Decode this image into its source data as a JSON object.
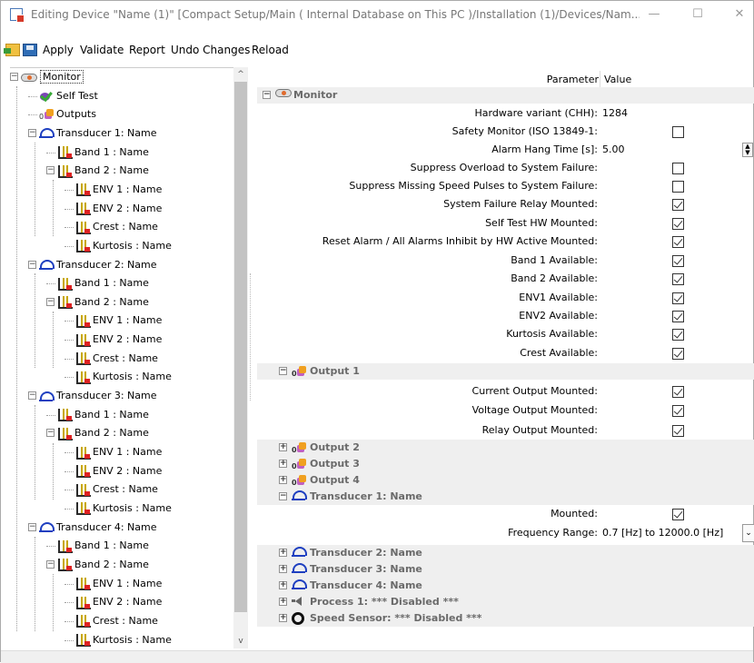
{
  "window": {
    "title": "Editing Device \"Name (1)\" [Compact Setup/Main ( Internal Database on This PC )/Installation (1)/Devices/Nam...",
    "minimize": "—",
    "maximize": "☐",
    "close": "✕"
  },
  "toolbar": {
    "apply": "Apply",
    "validate": "Validate",
    "report": "Report",
    "undo": "Undo Changes",
    "reload": "Reload"
  },
  "tree": [
    {
      "label": "Monitor",
      "icon": "monitor-icon",
      "depth": 0,
      "expander": "minus",
      "selected": true
    },
    {
      "label": "Self Test",
      "icon": "self-test-icon",
      "depth": 1
    },
    {
      "label": "Outputs",
      "icon": "outputs-icon",
      "depth": 1
    },
    {
      "label": "Transducer 1: Name",
      "icon": "transducer-icon",
      "depth": 1,
      "expander": "minus"
    },
    {
      "label": "Band 1 : Name",
      "icon": "band-icon",
      "depth": 2
    },
    {
      "label": "Band 2 : Name",
      "icon": "band-icon",
      "depth": 2,
      "expander": "minus"
    },
    {
      "label": "ENV 1 : Name",
      "icon": "band-icon",
      "depth": 3
    },
    {
      "label": "ENV 2 : Name",
      "icon": "band-icon",
      "depth": 3
    },
    {
      "label": "Crest : Name",
      "icon": "band-icon",
      "depth": 3
    },
    {
      "label": "Kurtosis : Name",
      "icon": "band-icon",
      "depth": 3
    },
    {
      "label": "Transducer 2: Name",
      "icon": "transducer-icon",
      "depth": 1,
      "expander": "minus"
    },
    {
      "label": "Band 1 : Name",
      "icon": "band-icon",
      "depth": 2
    },
    {
      "label": "Band 2 : Name",
      "icon": "band-icon",
      "depth": 2,
      "expander": "minus"
    },
    {
      "label": "ENV 1 : Name",
      "icon": "band-icon",
      "depth": 3
    },
    {
      "label": "ENV 2 : Name",
      "icon": "band-icon",
      "depth": 3
    },
    {
      "label": "Crest : Name",
      "icon": "band-icon",
      "depth": 3
    },
    {
      "label": "Kurtosis : Name",
      "icon": "band-icon",
      "depth": 3
    },
    {
      "label": "Transducer 3: Name",
      "icon": "transducer-icon",
      "depth": 1,
      "expander": "minus"
    },
    {
      "label": "Band 1 : Name",
      "icon": "band-icon",
      "depth": 2
    },
    {
      "label": "Band 2 : Name",
      "icon": "band-icon",
      "depth": 2,
      "expander": "minus"
    },
    {
      "label": "ENV 1 : Name",
      "icon": "band-icon",
      "depth": 3
    },
    {
      "label": "ENV 2 : Name",
      "icon": "band-icon",
      "depth": 3
    },
    {
      "label": "Crest : Name",
      "icon": "band-icon",
      "depth": 3
    },
    {
      "label": "Kurtosis : Name",
      "icon": "band-icon",
      "depth": 3
    },
    {
      "label": "Transducer 4: Name",
      "icon": "transducer-icon",
      "depth": 1,
      "expander": "minus"
    },
    {
      "label": "Band 1 : Name",
      "icon": "band-icon",
      "depth": 2
    },
    {
      "label": "Band 2 : Name",
      "icon": "band-icon",
      "depth": 2,
      "expander": "minus"
    },
    {
      "label": "ENV 1 : Name",
      "icon": "band-icon",
      "depth": 3
    },
    {
      "label": "ENV 2 : Name",
      "icon": "band-icon",
      "depth": 3
    },
    {
      "label": "Crest : Name",
      "icon": "band-icon",
      "depth": 3
    },
    {
      "label": "Kurtosis : Name",
      "icon": "band-icon",
      "depth": 3
    }
  ],
  "grid": {
    "header_parameter": "Parameter",
    "header_value": "Value",
    "rows": [
      {
        "kind": "group",
        "label": "Monitor",
        "icon": "monitor-icon",
        "indent": 0,
        "expander": "minus"
      },
      {
        "kind": "value",
        "label": "Hardware variant (CHH):",
        "value": "1284"
      },
      {
        "kind": "check",
        "label": "Safety Monitor (ISO 13849-1:",
        "checked": false
      },
      {
        "kind": "spin",
        "label": "Alarm Hang Time [s]:",
        "value": "5.00"
      },
      {
        "kind": "check",
        "label": "Suppress Overload to System Failure:",
        "checked": false
      },
      {
        "kind": "check",
        "label": "Suppress Missing Speed Pulses to System Failure:",
        "checked": false
      },
      {
        "kind": "check",
        "label": "System Failure Relay Mounted:",
        "checked": true
      },
      {
        "kind": "check",
        "label": "Self Test HW Mounted:",
        "checked": true
      },
      {
        "kind": "check",
        "label": "Reset Alarm / All Alarms Inhibit by HW Active Mounted:",
        "checked": true
      },
      {
        "kind": "check",
        "label": "Band 1 Available:",
        "checked": true
      },
      {
        "kind": "check",
        "label": "Band 2 Available:",
        "checked": true
      },
      {
        "kind": "check",
        "label": "ENV1 Available:",
        "checked": true
      },
      {
        "kind": "check",
        "label": "ENV2 Available:",
        "checked": true
      },
      {
        "kind": "check",
        "label": "Kurtosis Available:",
        "checked": true
      },
      {
        "kind": "check",
        "label": "Crest Available:",
        "checked": true
      },
      {
        "kind": "group",
        "label": "Output 1",
        "icon": "outputs-icon",
        "indent": 1,
        "expander": "minus"
      },
      {
        "kind": "check",
        "label": "Current Output Mounted:",
        "checked": true
      },
      {
        "kind": "check",
        "label": "Voltage Output Mounted:",
        "checked": true
      },
      {
        "kind": "check",
        "label": "Relay Output Mounted:",
        "checked": true
      },
      {
        "kind": "group",
        "label": "Output 2",
        "icon": "outputs-icon",
        "indent": 1,
        "expander": "plus"
      },
      {
        "kind": "group",
        "label": "Output 3",
        "icon": "outputs-icon",
        "indent": 1,
        "expander": "plus"
      },
      {
        "kind": "group",
        "label": "Output 4",
        "icon": "outputs-icon",
        "indent": 1,
        "expander": "plus"
      },
      {
        "kind": "group",
        "label": "Transducer 1: Name",
        "icon": "transducer-icon",
        "indent": 1,
        "expander": "minus"
      },
      {
        "kind": "check",
        "label": "Mounted:",
        "checked": true
      },
      {
        "kind": "dropdown",
        "label": "Frequency Range:",
        "value": "0.7 [Hz] to 12000.0 [Hz]"
      },
      {
        "kind": "group",
        "label": "Transducer 2: Name",
        "icon": "transducer-icon",
        "indent": 1,
        "expander": "plus"
      },
      {
        "kind": "group",
        "label": "Transducer 3: Name",
        "icon": "transducer-icon",
        "indent": 1,
        "expander": "plus"
      },
      {
        "kind": "group",
        "label": "Transducer 4: Name",
        "icon": "transducer-icon",
        "indent": 1,
        "expander": "plus"
      },
      {
        "kind": "group",
        "label": "Process 1:  *** Disabled ***",
        "icon": "speaker-icon",
        "indent": 1,
        "expander": "plus"
      },
      {
        "kind": "group",
        "label": "Speed Sensor:  *** Disabled ***",
        "icon": "speed-sensor-icon",
        "indent": 1,
        "expander": "plus"
      }
    ]
  }
}
